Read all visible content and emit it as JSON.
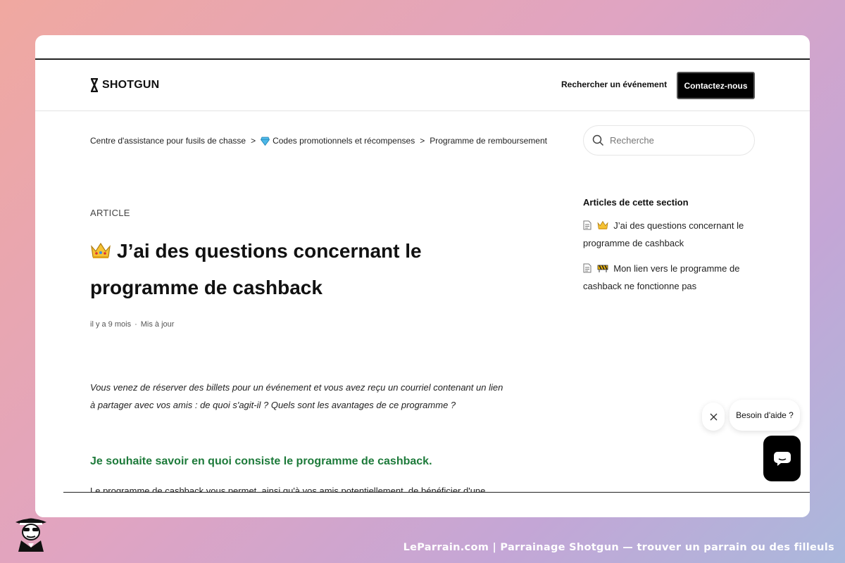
{
  "header": {
    "brand": "SHOTGUN",
    "nav_link": "Rechercher un événement",
    "contact_button": "Contactez-nous"
  },
  "breadcrumb": [
    {
      "label": "Centre d'assistance pour fusils de chasse"
    },
    {
      "label": "Codes promotionnels et récompenses",
      "icon": "gem-icon"
    },
    {
      "label": "Programme de remboursement"
    }
  ],
  "breadcrumb_separator": ">",
  "search": {
    "placeholder": "Recherche"
  },
  "article": {
    "label": "ARTICLE",
    "title": "J’ai des questions concernant le programme de cashback",
    "title_icon": "crown-icon",
    "age": "il y a 9 mois",
    "updated": "Mis à jour",
    "intro": "Vous venez de réserver des billets pour un événement et vous avez reçu un courriel contenant un lien à partager avec vos amis : de quoi s'agit-il ? Quels sont les avantages de ce programme ?",
    "section_heading": "Je souhaite savoir en quoi consiste le programme de cashback.",
    "partial_text": "Le programme de cashback vous permet, ainsi qu'à vos amis potentiellement, de bénéficier d'une"
  },
  "sidebar": {
    "title": "Articles de cette section",
    "items": [
      {
        "label": "J’ai des questions concernant le programme de cashback",
        "icon": "crown-icon"
      },
      {
        "label": "Mon lien vers le programme de cashback ne fonctionne pas",
        "icon": "construction-icon"
      }
    ]
  },
  "widget": {
    "help_text": "Besoin d'aide ?"
  },
  "caption": "LeParrain.com | Parrainage Shotgun — trouver un parrain ou des filleuls",
  "colors": {
    "accent_green": "#1d7a3a",
    "button_black": "#000000"
  }
}
